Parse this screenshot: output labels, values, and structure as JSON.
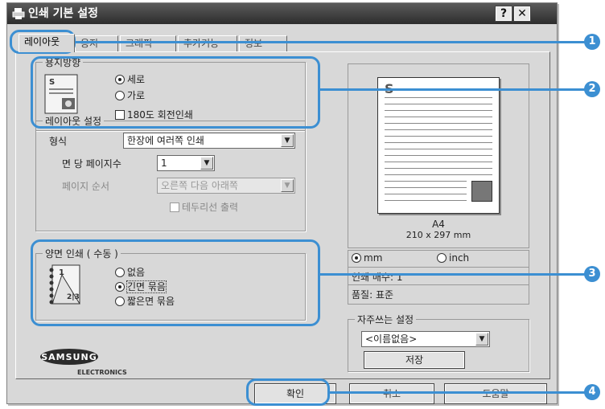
{
  "window": {
    "title": "인쇄 기본 설정",
    "help_label": "?",
    "close_label": "✕"
  },
  "tabs": [
    {
      "label": "레이아웃"
    },
    {
      "label": "용지"
    },
    {
      "label": "그래픽"
    },
    {
      "label": "추가기능"
    },
    {
      "label": "정보"
    }
  ],
  "orientation": {
    "title": "용지방향",
    "portrait": "세로",
    "landscape": "가로",
    "rotate180": "180도 회전인쇄",
    "selected": "세로"
  },
  "layout": {
    "title": "레이아웃 설정",
    "type_label": "형식",
    "type_value": "한장에 여러쪽 인쇄",
    "pages_per_side_label": "면 당 페이지수",
    "pages_per_side_value": "1",
    "page_order_label": "페이지 순서",
    "page_order_value": "오른쪽 다음 아래쪽",
    "print_border": "테두리선 출력"
  },
  "duplex": {
    "title": "양면 인쇄 ( 수동 )",
    "none": "없음",
    "long_edge": "긴면 묶음",
    "short_edge": "짧은면 묶음",
    "selected": "긴면 묶음"
  },
  "preview": {
    "paper_size": "A4",
    "paper_dims": "210 x 297 mm",
    "unit_mm": "mm",
    "unit_inch": "inch",
    "unit_selected": "mm",
    "copies": "인쇄 매수: 1",
    "quality": "품질: 표준"
  },
  "favorites": {
    "title": "자주쓰는 설정",
    "value": "<이름없음>",
    "save_label": "저장"
  },
  "brand": {
    "name": "SAMSUNG",
    "sub": "ELECTRONICS"
  },
  "buttons": {
    "ok": "확인",
    "cancel": "취소",
    "help": "도움말"
  },
  "callouts": [
    "1",
    "2",
    "3",
    "4"
  ],
  "colors": {
    "callout": "#3c8fd2",
    "titlebar": "#3a3a3a",
    "dialog_bg": "#d8d8d8"
  }
}
